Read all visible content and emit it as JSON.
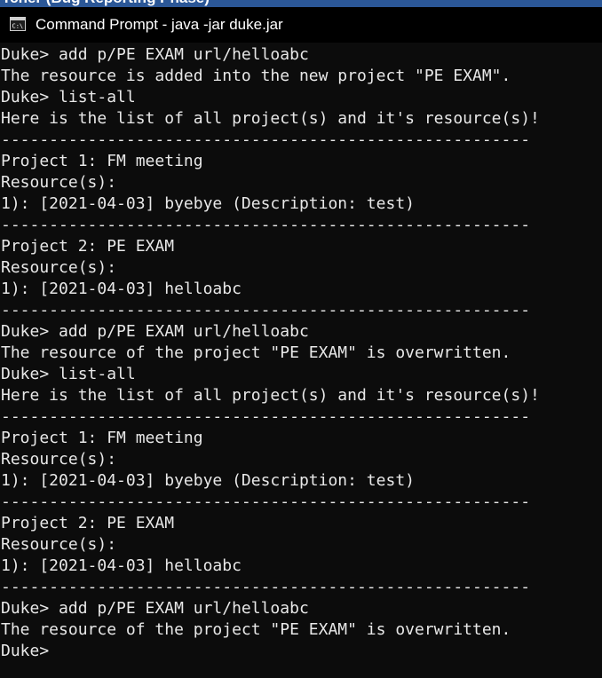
{
  "background_window": {
    "title_fragment": "Tcher (Bug Reporting Phase)"
  },
  "window": {
    "title": "Command Prompt - java  -jar duke.jar",
    "icon": "cmd-icon"
  },
  "console": {
    "lines": [
      "Duke> add p/PE EXAM url/helloabc",
      "The resource is added into the new project \"PE EXAM\".",
      "Duke> list-all",
      "Here is the list of all project(s) and it's resource(s)!",
      "-------------------------------------------------------",
      "Project 1: FM meeting",
      "Resource(s):",
      "1): [2021-04-03] byebye (Description: test)",
      "-------------------------------------------------------",
      "Project 2: PE EXAM",
      "Resource(s):",
      "1): [2021-04-03] helloabc",
      "-------------------------------------------------------",
      "Duke> add p/PE EXAM url/helloabc",
      "The resource of the project \"PE EXAM\" is overwritten.",
      "Duke> list-all",
      "Here is the list of all project(s) and it's resource(s)!",
      "-------------------------------------------------------",
      "Project 1: FM meeting",
      "Resource(s):",
      "1): [2021-04-03] byebye (Description: test)",
      "-------------------------------------------------------",
      "Project 2: PE EXAM",
      "Resource(s):",
      "1): [2021-04-03] helloabc",
      "-------------------------------------------------------",
      "Duke> add p/PE EXAM url/helloabc",
      "The resource of the project \"PE EXAM\" is overwritten.",
      "Duke>"
    ]
  }
}
